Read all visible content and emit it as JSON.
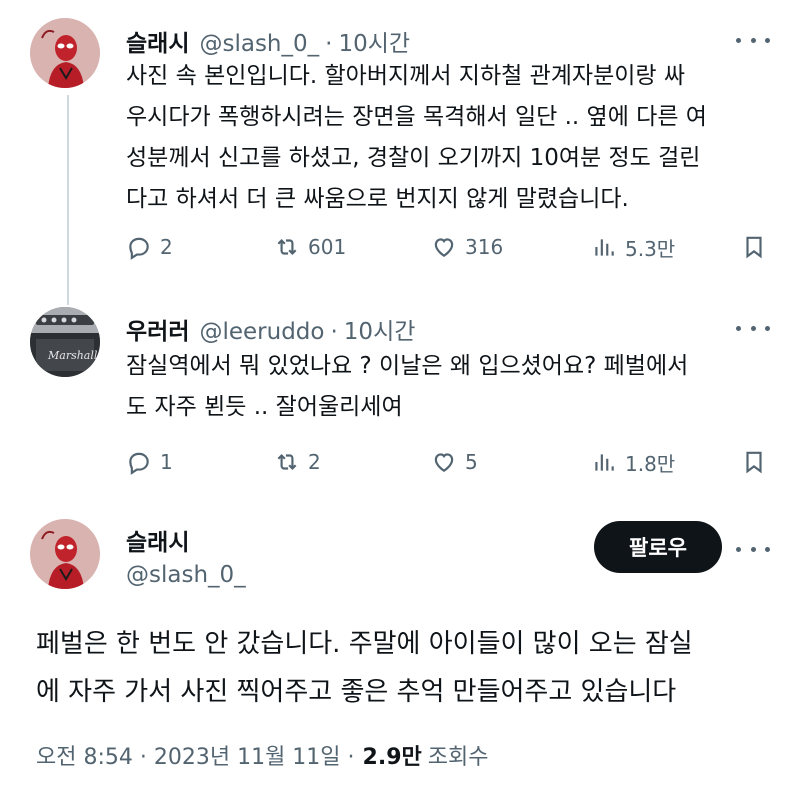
{
  "tweets": [
    {
      "name": "슬래시",
      "handle": "@slash_0_",
      "separator": "·",
      "time": "10시간",
      "text": "사진 속 본인입니다. 할아버지께서 지하철 관계자분이랑 싸\n우시다가 폭행하시려는 장면을 목격해서 일단 .. 옆에 다른 여\n성분께서 신고를 하셨고, 경찰이 오기까지 10여분 정도 걸린\n다고 하셔서 더 큰 싸움으로 번지지 않게 말렸습니다.",
      "replies": "2",
      "retweets": "601",
      "likes": "316",
      "views": "5.3만"
    },
    {
      "name": "우러러",
      "handle": "@leeruddo",
      "separator": "·",
      "time": "10시간",
      "text": "잠실역에서 뭐 있었나요 ? 이날은 왜 입으셨어요?  페벌에서\n도 자주 뵌듯 .. 잘어울리세여",
      "replies": "1",
      "retweets": "2",
      "likes": "5",
      "views": "1.8만"
    }
  ],
  "main_tweet": {
    "name": "슬래시",
    "handle": "@slash_0_",
    "follow_label": "팔로우",
    "text": "페벌은 한 번도 안 갔습니다. 주말에 아이들이 많이 오는 잠실\n에 자주 가서 사진 찍어주고 좋은 추억 만들어주고 있습니다",
    "timestamp": "오전 8:54 · 2023년 11월 11일 ·",
    "views_count": "2.9만",
    "views_label": "조회수"
  },
  "icons": {
    "reply": "reply-icon",
    "retweet": "retweet-icon",
    "like": "heart-icon",
    "views": "views-chart-icon",
    "bookmark": "bookmark-icon",
    "more": "more-dots-icon"
  },
  "colors": {
    "text": "#0f1419",
    "secondary": "#536471",
    "thread_line": "#cfd9de",
    "follow_button": "#0f1419"
  }
}
